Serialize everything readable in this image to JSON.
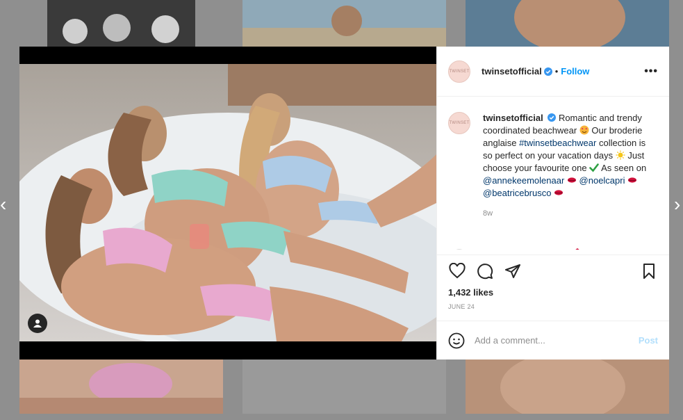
{
  "post": {
    "username": "twinsetofficial",
    "avatar_text": "TWINSET",
    "follow_label": "Follow",
    "dot": "•",
    "more_label": "•••",
    "caption": {
      "username": "twinsetofficial",
      "text_1": "Romantic and trendy coordinated beachwear",
      "text_2": "Our broderie anglaise",
      "hashtag": "#twinsetbeachwear",
      "text_3": "collection is so perfect on your vacation days",
      "text_4": "Just choose your favourite one",
      "text_5": "As seen on",
      "mention_1": "@annekeemolenaar",
      "mention_2": "@noelcapri",
      "mention_3": "@beatricebrusco"
    },
    "timestamp": "8w",
    "likes": "1,432 likes",
    "date": "JUNE 24",
    "comment_placeholder": "Add a comment...",
    "post_label": "Post"
  },
  "nav": {
    "prev": "‹",
    "next": "›"
  },
  "icons": {
    "like": "heart-icon",
    "comment": "comment-icon",
    "share": "paper-plane-icon",
    "save": "bookmark-icon",
    "emoji": "smiley-icon",
    "user_tag": "user-tag-icon",
    "verified": "verified-badge-icon"
  },
  "colors": {
    "accent": "#0095f6",
    "link": "#00376b",
    "post_disabled": "#b2dffc",
    "muted": "#8e8e8e"
  }
}
